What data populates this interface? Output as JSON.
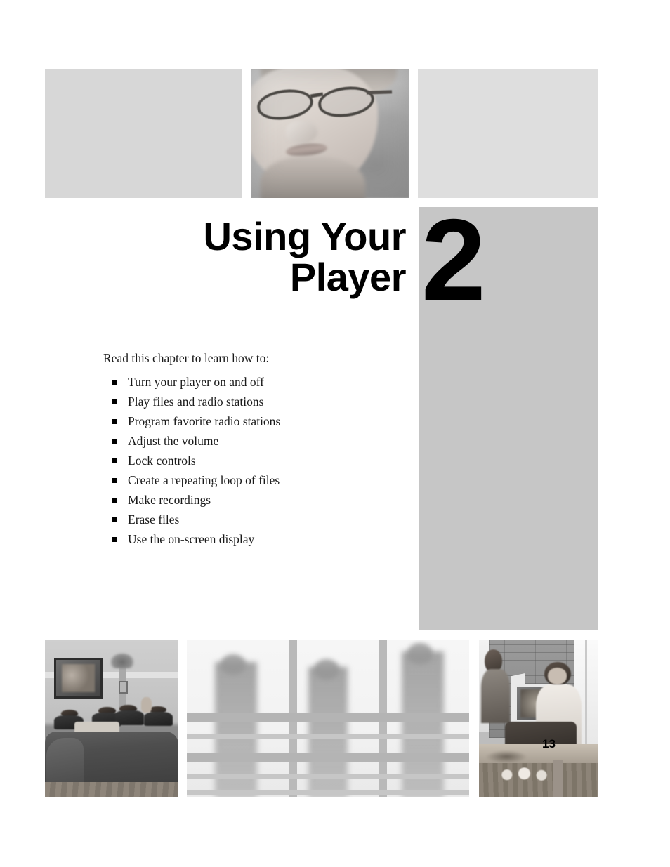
{
  "page": {
    "number": "13",
    "background_color": "#ffffff"
  },
  "chapter": {
    "title": "Using Your\nPlayer",
    "number": "2",
    "panel_color": "#c6c6c6",
    "title_color": "#000000"
  },
  "intro": {
    "text": "Read this chapter to learn how to:"
  },
  "topics": [
    {
      "label": "Turn your player on and off"
    },
    {
      "label": "Play files and radio stations"
    },
    {
      "label": "Program favorite radio stations"
    },
    {
      "label": "Adjust the volume"
    },
    {
      "label": "Lock controls"
    },
    {
      "label": "Create a repeating loop of files"
    },
    {
      "label": "Make recordings"
    },
    {
      "label": "Erase files"
    },
    {
      "label": "Use the on-screen display"
    }
  ],
  "images": {
    "top": [
      {
        "name": "top-left-placeholder",
        "description": "blank light gray placeholder block",
        "color": "#d7d7d7"
      },
      {
        "name": "top-portrait",
        "description": "black and white close-up photo of a smiling woman wearing eyeglasses",
        "color": "#b9b9b9"
      },
      {
        "name": "top-right-placeholder",
        "description": "blank light gray placeholder block",
        "color": "#dedede"
      }
    ],
    "bottom": [
      {
        "name": "living-room-photo",
        "description": "group of people sitting on a couch in a living room watching a framed television"
      },
      {
        "name": "silhouettes-photo",
        "description": "blurred silhouettes of three people walking behind a window railing"
      },
      {
        "name": "loft-photo",
        "description": "people in a brick loft room with a framed picture and a table with cups"
      }
    ]
  }
}
